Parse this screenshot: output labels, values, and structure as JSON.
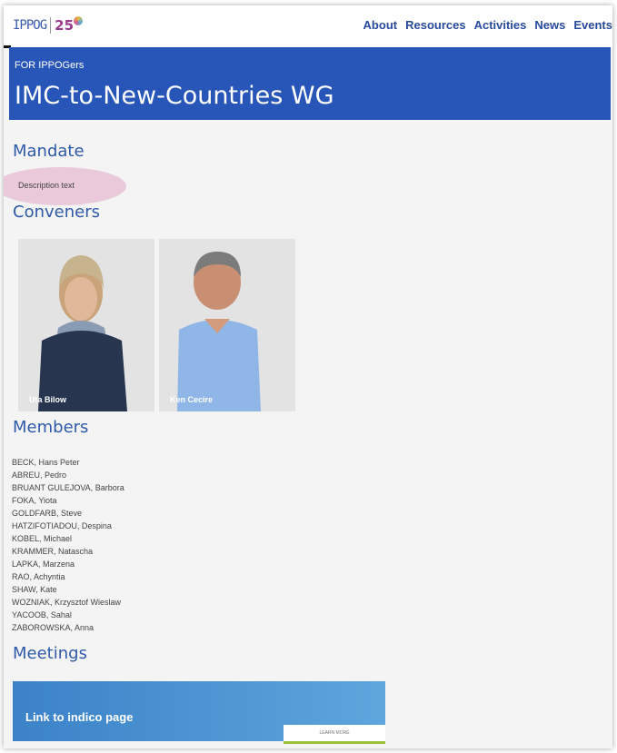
{
  "header": {
    "logo_text": "IPPOG",
    "anniversary_text": "25",
    "nav": [
      "About",
      "Resources",
      "Activities",
      "News",
      "Events"
    ]
  },
  "hero": {
    "kicker": "FOR IPPOGers",
    "title": "IMC-to-New-Countries WG"
  },
  "mandate": {
    "title": "Mandate",
    "description": "Description text"
  },
  "conveners": {
    "title": "Conveners",
    "people": [
      {
        "name": "Uta Bilow"
      },
      {
        "name": "Ken Cecire"
      }
    ]
  },
  "members": {
    "title": "Members",
    "list": [
      "BECK, Hans Peter",
      "ABREU, Pedro",
      "BRUANT GULEJOVA, Barbora",
      "FOKA, Yiota",
      "GOLDFARB, Steve",
      "HATZIFOTIADOU, Despina",
      "KOBEL, Michael",
      "KRAMMER, Natascha",
      "LAPKA, Marzena",
      "RAO, Achyntia",
      "SHAW, Kate",
      "WOZNIAK, Krzysztof Wieslaw",
      "YACOOB, Sahal",
      "ZABOROWSKA, Anna"
    ]
  },
  "meetings": {
    "title": "Meetings",
    "banner_label": "Link to indico page",
    "learn_more": "LEARN MORE"
  },
  "colors": {
    "brand_blue": "#2856b8",
    "nav_blue": "#284a9c",
    "heading_blue": "#2f5aa8",
    "accent_green": "#9ac23a"
  }
}
